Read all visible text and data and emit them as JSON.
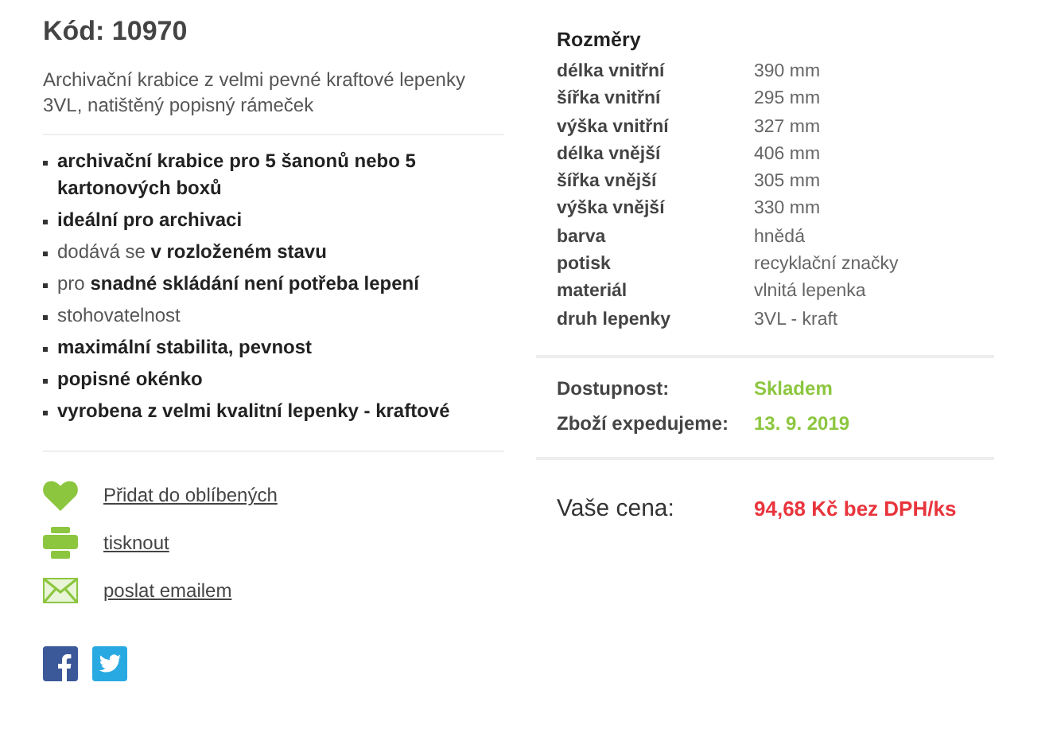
{
  "product": {
    "code": "Kód: 10970",
    "description": "Archivační krabice z velmi pevné kraftové lepenky 3VL, natištěný popisný rámeček"
  },
  "features": [
    {
      "text": "archivační krabice pro 5 šanonů nebo 5 kartonových boxů",
      "bold": true
    },
    {
      "text": "ideální pro archivaci",
      "bold": true
    },
    {
      "text": "dodává se **v rozloženém stavu**",
      "bold": false
    },
    {
      "text": "pro **snadné skládání není potřeba lepení**",
      "bold": false
    },
    {
      "text": "stohovatelnost",
      "bold": false
    },
    {
      "text": "maximální stabilita, pevnost",
      "bold": true
    },
    {
      "text": "popisné okénko",
      "bold": true
    },
    {
      "text": "vyrobena z velmi kvalitní lepenky - kraftové",
      "bold": true
    }
  ],
  "actions": [
    {
      "kind": "favorite",
      "label": "Přidat do oblíbených"
    },
    {
      "kind": "print",
      "label": "tisknout"
    },
    {
      "kind": "email",
      "label": "poslat emailem"
    }
  ],
  "social": [
    {
      "kind": "facebook"
    },
    {
      "kind": "twitter"
    }
  ],
  "dimensions": {
    "title": "Rozměry",
    "rows": [
      {
        "label": "délka vnitřní",
        "value": "390 mm"
      },
      {
        "label": "šířka vnitřní",
        "value": "295 mm"
      },
      {
        "label": "výška vnitřní",
        "value": "327 mm"
      },
      {
        "label": "délka vnější",
        "value": "406 mm"
      },
      {
        "label": "šířka vnější",
        "value": "305 mm"
      },
      {
        "label": "výška vnější",
        "value": "330 mm"
      },
      {
        "label": "barva",
        "value": "hnědá"
      },
      {
        "label": "potisk",
        "value": "recyklační značky"
      },
      {
        "label": "materiál",
        "value": "vlnitá lepenka"
      },
      {
        "label": "druh lepenky",
        "value": "3VL - kraft"
      }
    ]
  },
  "availability": [
    {
      "label": "Dostupnost:",
      "value": "Skladem"
    },
    {
      "label": "Zboží expedujeme:",
      "value": "13. 9. 2019"
    }
  ],
  "price": {
    "label": "Vaše cena:",
    "value": "94,68 Kč bez DPH/ks"
  }
}
